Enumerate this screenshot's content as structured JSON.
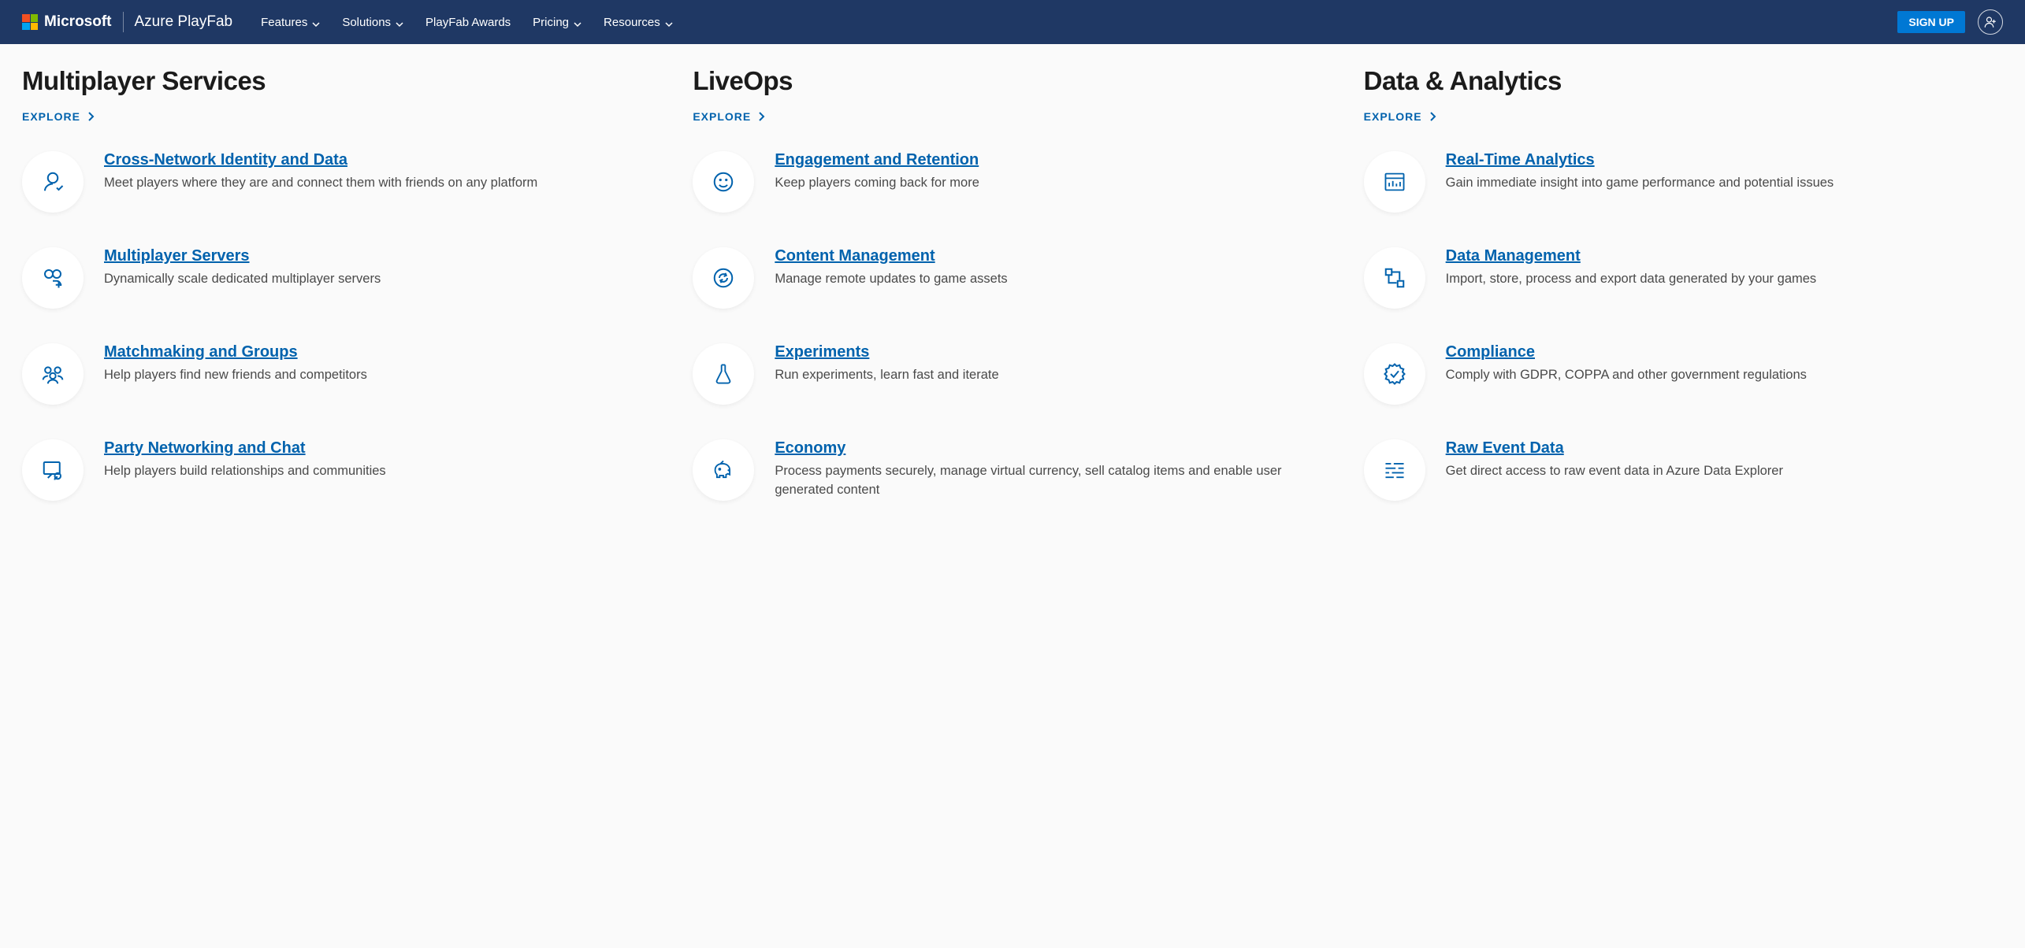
{
  "header": {
    "company": "Microsoft",
    "product": "Azure PlayFab",
    "nav": {
      "features": "Features",
      "solutions": "Solutions",
      "awards": "PlayFab Awards",
      "pricing": "Pricing",
      "resources": "Resources"
    },
    "signup": "SIGN UP"
  },
  "explore_label": "EXPLORE",
  "columns": {
    "multiplayer": {
      "title": "Multiplayer Services",
      "items": [
        {
          "title": "Cross-Network Identity and Data",
          "desc": "Meet players where they are and connect them with friends on any platform"
        },
        {
          "title": "Multiplayer Servers",
          "desc": "Dynamically scale dedicated multiplayer servers"
        },
        {
          "title": "Matchmaking and Groups",
          "desc": "Help players find new friends and competitors"
        },
        {
          "title": "Party Networking and Chat",
          "desc": "Help players build relationships and communities"
        }
      ]
    },
    "liveops": {
      "title": "LiveOps",
      "items": [
        {
          "title": "Engagement and Retention",
          "desc": "Keep players coming back for more"
        },
        {
          "title": "Content Management",
          "desc": "Manage remote updates to game assets"
        },
        {
          "title": "Experiments",
          "desc": "Run experiments, learn fast and iterate"
        },
        {
          "title": "Economy",
          "desc": "Process payments securely, manage virtual currency, sell catalog items and enable user generated content"
        }
      ]
    },
    "data": {
      "title": "Data & Analytics",
      "items": [
        {
          "title": "Real-Time Analytics",
          "desc": "Gain immediate insight into game performance and potential issues"
        },
        {
          "title": "Data Management",
          "desc": "Import, store, process and export data generated by your games"
        },
        {
          "title": "Compliance",
          "desc": "Comply with GDPR, COPPA and other government regulations"
        },
        {
          "title": "Raw Event Data",
          "desc": "Get direct access to raw event data in Azure Data Explorer"
        }
      ]
    }
  }
}
